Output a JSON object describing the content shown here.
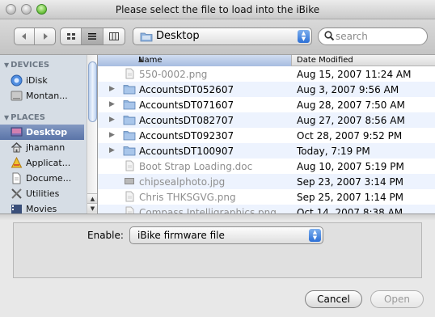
{
  "window": {
    "title": "Please select the file to load into the iBike"
  },
  "toolbar": {
    "back_icon": "back-arrow-icon",
    "forward_icon": "forward-arrow-icon",
    "view_icons": [
      "icon-view-icon",
      "list-view-icon",
      "column-view-icon"
    ],
    "location": "Desktop",
    "search_placeholder": "search"
  },
  "sidebar": {
    "devices_header": "DEVICES",
    "places_header": "PLACES",
    "devices": [
      {
        "label": "iDisk",
        "icon": "idisk-icon"
      },
      {
        "label": "Montan...",
        "icon": "hard-drive-icon"
      }
    ],
    "places": [
      {
        "label": "Desktop",
        "icon": "desktop-icon",
        "selected": true
      },
      {
        "label": "jhamann",
        "icon": "home-icon"
      },
      {
        "label": "Applicat...",
        "icon": "applications-icon"
      },
      {
        "label": "Docume...",
        "icon": "documents-icon"
      },
      {
        "label": "Utilities",
        "icon": "utilities-icon"
      },
      {
        "label": "Movies",
        "icon": "movies-icon"
      }
    ]
  },
  "filelist": {
    "columns": {
      "name": "Name",
      "date": "Date Modified"
    },
    "rows": [
      {
        "name": "550-0002.png",
        "date": "Aug 15, 2007 11:24 AM",
        "kind": "file",
        "enabled": false
      },
      {
        "name": "AccountsDT052607",
        "date": "Aug 3, 2007 9:56 AM",
        "kind": "folder",
        "enabled": true
      },
      {
        "name": "AccountsDT071607",
        "date": "Aug 28, 2007 7:50 AM",
        "kind": "folder",
        "enabled": true
      },
      {
        "name": "AccountsDT082707",
        "date": "Aug 27, 2007 8:56 AM",
        "kind": "folder",
        "enabled": true
      },
      {
        "name": "AccountsDT092307",
        "date": "Oct 28, 2007 9:52 PM",
        "kind": "folder",
        "enabled": true
      },
      {
        "name": "AccountsDT100907",
        "date": "Today, 7:19 PM",
        "kind": "folder",
        "enabled": true
      },
      {
        "name": "Boot Strap Loading.doc",
        "date": "Aug 10, 2007 5:19 PM",
        "kind": "file",
        "enabled": false
      },
      {
        "name": "chipsealphoto.jpg",
        "date": "Sep 23, 2007 3:14 PM",
        "kind": "image",
        "enabled": false
      },
      {
        "name": "Chris THKSGVG.png",
        "date": "Sep 25, 2007 1:14 PM",
        "kind": "file",
        "enabled": false
      },
      {
        "name": "Compass Intelligraphics.png",
        "date": "Oct 14, 2007 8:38 AM",
        "kind": "file",
        "enabled": false
      }
    ]
  },
  "accessory": {
    "enable_label": "Enable:",
    "enable_value": "iBike firmware file"
  },
  "buttons": {
    "cancel": "Cancel",
    "open": "Open"
  },
  "colors": {
    "selection": "#5a74a8",
    "sidebar_bg": "#d6dde5",
    "row_alt": "#edf3fe",
    "folder": "#8fb3de"
  }
}
